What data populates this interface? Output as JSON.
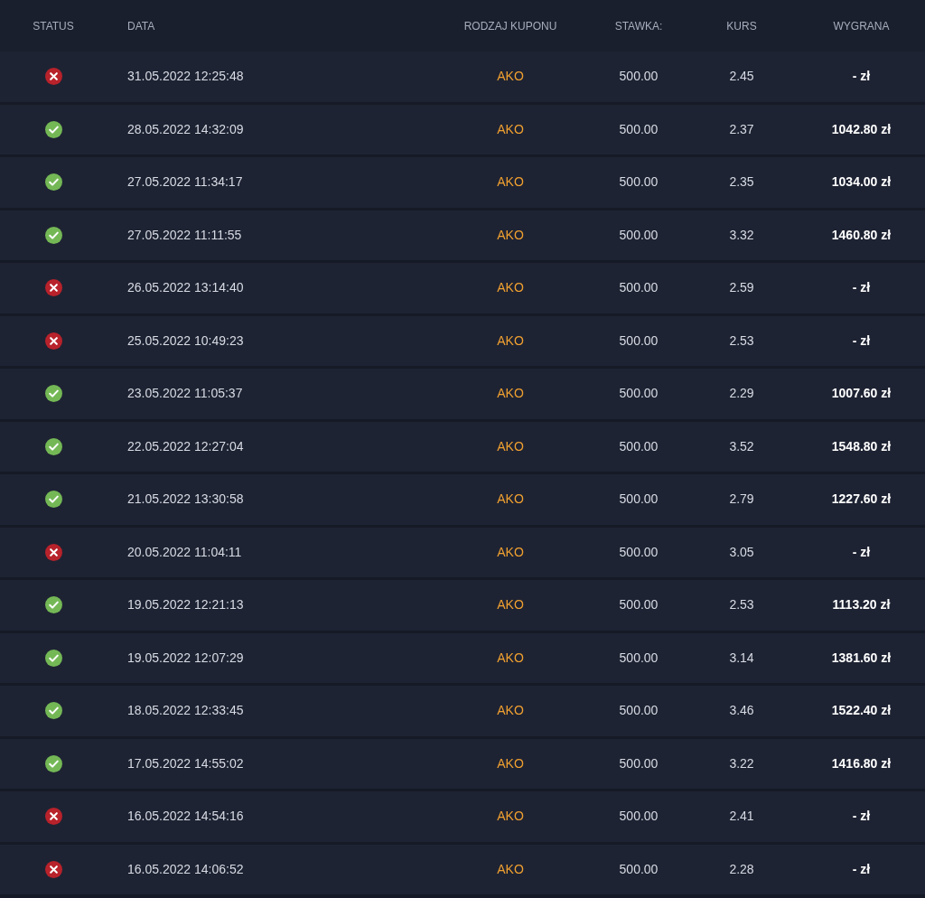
{
  "table": {
    "columns": [
      "STATUS",
      "DATA",
      "RODZAJ KUPONU",
      "STAWKA:",
      "KURS",
      "WYGRANA"
    ],
    "rows": [
      {
        "kind": "lost",
        "date": "31.05.2022 12:25:48",
        "type": "AKO",
        "stake": "500.00",
        "odds": "2.45",
        "win": "- zł"
      },
      {
        "kind": "won",
        "date": "28.05.2022 14:32:09",
        "type": "AKO",
        "stake": "500.00",
        "odds": "2.37",
        "win": "1042.80 zł"
      },
      {
        "kind": "won",
        "date": "27.05.2022 11:34:17",
        "type": "AKO",
        "stake": "500.00",
        "odds": "2.35",
        "win": "1034.00 zł"
      },
      {
        "kind": "won",
        "date": "27.05.2022 11:11:55",
        "type": "AKO",
        "stake": "500.00",
        "odds": "3.32",
        "win": "1460.80 zł"
      },
      {
        "kind": "lost",
        "date": "26.05.2022 13:14:40",
        "type": "AKO",
        "stake": "500.00",
        "odds": "2.59",
        "win": "- zł"
      },
      {
        "kind": "lost",
        "date": "25.05.2022 10:49:23",
        "type": "AKO",
        "stake": "500.00",
        "odds": "2.53",
        "win": "- zł"
      },
      {
        "kind": "won",
        "date": "23.05.2022 11:05:37",
        "type": "AKO",
        "stake": "500.00",
        "odds": "2.29",
        "win": "1007.60 zł"
      },
      {
        "kind": "won",
        "date": "22.05.2022 12:27:04",
        "type": "AKO",
        "stake": "500.00",
        "odds": "3.52",
        "win": "1548.80 zł"
      },
      {
        "kind": "won",
        "date": "21.05.2022 13:30:58",
        "type": "AKO",
        "stake": "500.00",
        "odds": "2.79",
        "win": "1227.60 zł"
      },
      {
        "kind": "lost",
        "date": "20.05.2022 11:04:11",
        "type": "AKO",
        "stake": "500.00",
        "odds": "3.05",
        "win": "- zł"
      },
      {
        "kind": "won",
        "date": "19.05.2022 12:21:13",
        "type": "AKO",
        "stake": "500.00",
        "odds": "2.53",
        "win": "1113.20 zł"
      },
      {
        "kind": "won",
        "date": "19.05.2022 12:07:29",
        "type": "AKO",
        "stake": "500.00",
        "odds": "3.14",
        "win": "1381.60 zł"
      },
      {
        "kind": "won",
        "date": "18.05.2022 12:33:45",
        "type": "AKO",
        "stake": "500.00",
        "odds": "3.46",
        "win": "1522.40 zł"
      },
      {
        "kind": "won",
        "date": "17.05.2022 14:55:02",
        "type": "AKO",
        "stake": "500.00",
        "odds": "3.22",
        "win": "1416.80 zł"
      },
      {
        "kind": "lost",
        "date": "16.05.2022 14:54:16",
        "type": "AKO",
        "stake": "500.00",
        "odds": "2.41",
        "win": "- zł"
      },
      {
        "kind": "lost",
        "date": "16.05.2022 14:06:52",
        "type": "AKO",
        "stake": "500.00",
        "odds": "2.28",
        "win": "- zł"
      }
    ]
  }
}
